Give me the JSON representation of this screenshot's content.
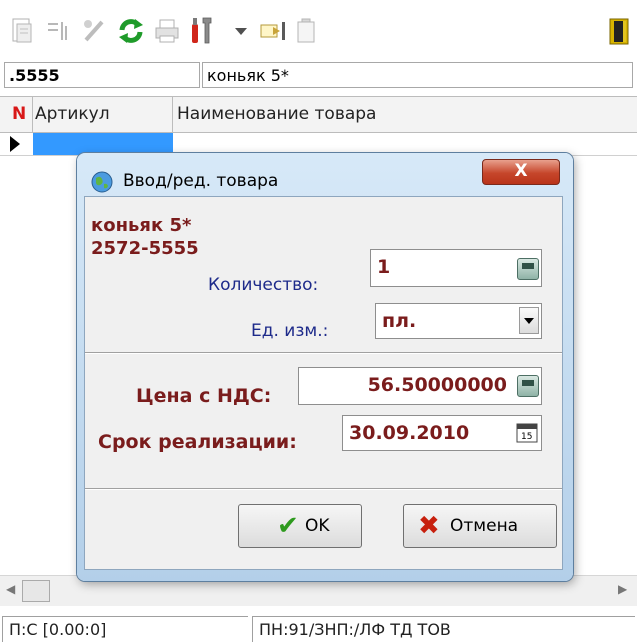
{
  "filters": {
    "code": ".5555",
    "name": "коньяк 5*"
  },
  "grid": {
    "columns": [
      {
        "label": "N",
        "color": "#d81818"
      },
      {
        "label": "Артикул"
      },
      {
        "label": "Наименование товара"
      }
    ]
  },
  "dialog": {
    "title": "Ввод/ред. товара",
    "close_label": "X",
    "product_name": "коньяк 5*",
    "product_code": "2572-5555",
    "quantity_label": "Количество:",
    "quantity_value": "1",
    "unit_label": "Ед. изм.:",
    "unit_value": "пл.",
    "price_label": "Цена с НДС:",
    "price_value": "56.50000000",
    "expiry_label": "Срок реализации:",
    "expiry_value": "30.09.2010",
    "ok_label": "OK",
    "cancel_label": "Отмена"
  },
  "status": {
    "left": "П:C [0.00:0]",
    "right": "ПН:91/ЗНП:/ЛФ ТД ТОВ"
  },
  "colors": {
    "accent_red": "#7a1c1c",
    "label_blue": "#1d2a8a",
    "selection_blue": "#3399ff"
  }
}
